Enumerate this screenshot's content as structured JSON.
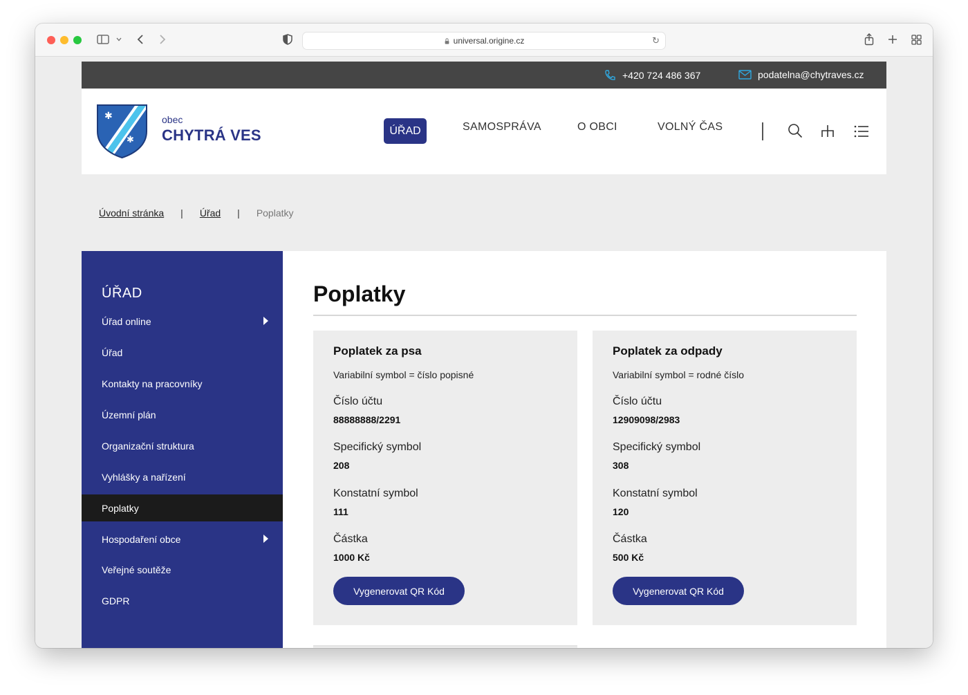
{
  "browser": {
    "url": "universal.origine.cz"
  },
  "topbar": {
    "phone": "+420 724 486 367",
    "email": "podatelna@chytraves.cz"
  },
  "brand": {
    "small": "obec",
    "name": "CHYTRÁ VES"
  },
  "nav": {
    "items": [
      "ÚŘAD",
      "SAMOSPRÁVA",
      "O OBCI",
      "VOLNÝ ČAS"
    ],
    "active": "ÚŘAD"
  },
  "breadcrumb": {
    "home": "Úvodní stránka",
    "parent": "Úřad",
    "current": "Poplatky",
    "separator": "|"
  },
  "sidebar": {
    "title": "ÚŘAD",
    "items": [
      {
        "label": "Úřad online"
      },
      {
        "label": "Úřad"
      },
      {
        "label": "Kontakty na pracovníky"
      },
      {
        "label": "Územní plán"
      },
      {
        "label": "Organizační struktura"
      },
      {
        "label": "Vyhlášky a nařízení"
      },
      {
        "label": "Poplatky"
      },
      {
        "label": "Hospodaření obce"
      },
      {
        "label": "Veřejné soutěže"
      },
      {
        "label": "GDPR"
      }
    ]
  },
  "main": {
    "title": "Poplatky",
    "labels": {
      "account": "Číslo účtu",
      "specific": "Specifický symbol",
      "constant": "Konstatní symbol",
      "amount": "Částka"
    },
    "cards": [
      {
        "title": "Poplatek za psa",
        "variable": "Variabilní symbol = číslo popisné",
        "account": "88888888/2291",
        "specific": "208",
        "constant": "111",
        "amount": "1000 Kč",
        "button": "Vygenerovat QR Kód"
      },
      {
        "title": "Poplatek za odpady",
        "variable": "Variabilní symbol = rodné číslo",
        "account": "12909098/2983",
        "specific": "308",
        "constant": "120",
        "amount": "500 Kč",
        "button": "Vygenerovat QR Kód"
      }
    ]
  },
  "colors": {
    "primary": "#2a3486",
    "topbar": "#454545",
    "accent": "#2fa8e0",
    "active_sidebar": "#1b1b1b"
  }
}
